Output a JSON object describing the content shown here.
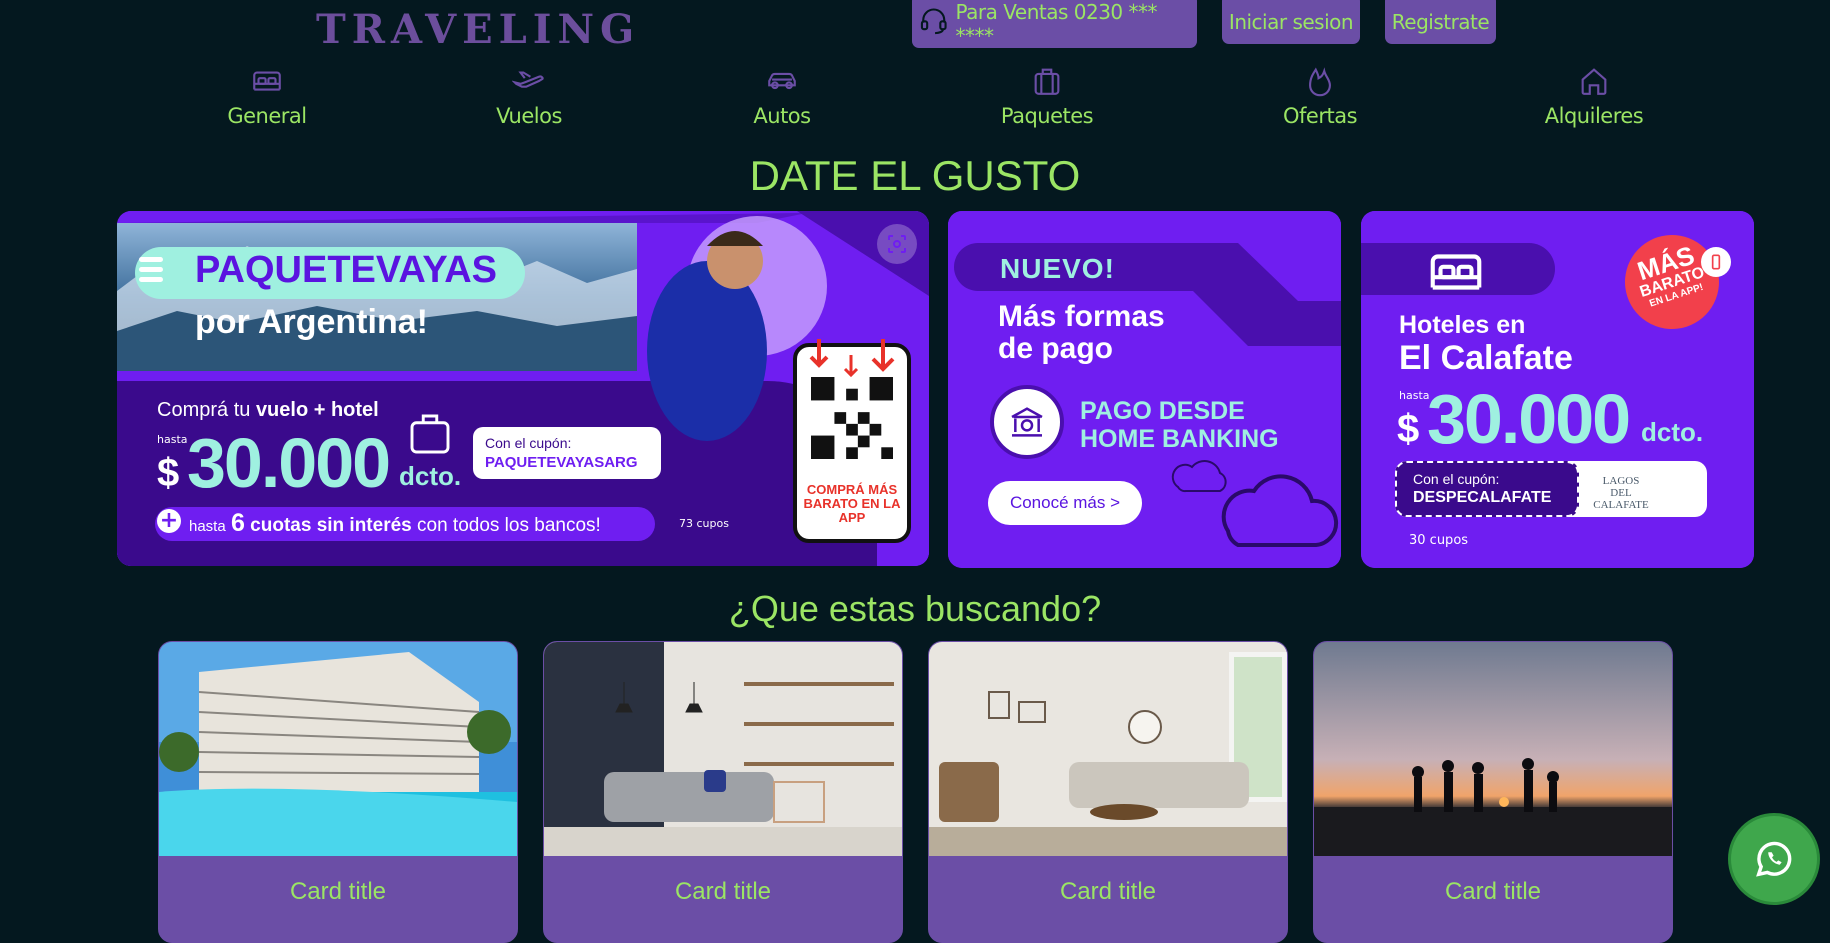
{
  "header": {
    "logo": "TRAVELING",
    "sales_label": "Para Ventas 0230 *** ****",
    "login_label": "Iniciar sesion",
    "register_label": "Registrate"
  },
  "nav": [
    {
      "label": "General",
      "icon": "bed-icon"
    },
    {
      "label": "Vuelos",
      "icon": "plane-icon"
    },
    {
      "label": "Autos",
      "icon": "car-icon"
    },
    {
      "label": "Paquetes",
      "icon": "suitcase-icon"
    },
    {
      "label": "Ofertas",
      "icon": "flame-icon"
    },
    {
      "label": "Alquileres",
      "icon": "house-icon"
    }
  ],
  "promo_heading": "DATE EL GUSTO",
  "banners": {
    "b1": {
      "brand": "PAQUETEVAYAS",
      "sub": "por Argentina!",
      "buy_pre": "Comprá tu",
      "buy_bold": "vuelo + hotel",
      "hasta": "hasta",
      "currency": "$",
      "amount": "30.000",
      "dcto": "dcto.",
      "coupon_label": "Con el cupón:",
      "coupon_code": "PAQUETEVAYASARG",
      "cuotas_pre": "hasta",
      "cuotas_num": "6",
      "cuotas_bold": "cuotas sin interés",
      "cuotas_post": "con todos los bancos!",
      "cupos": "73 cupos",
      "qr_text": "COMPRÁ MÁS BARATO EN LA APP"
    },
    "b2": {
      "badge": "NUEVO!",
      "title_line1": "Más formas",
      "title_line2": "de pago",
      "pago_line1": "PAGO DESDE",
      "pago_line2": "HOME BANKING",
      "cta": "Conocé más >"
    },
    "b3": {
      "sticker_line1": "MÁS",
      "sticker_line2": "BARATO",
      "sticker_line3": "EN LA APP!",
      "title_line1": "Hoteles en",
      "title_line2": "El Calafate",
      "hasta": "hasta",
      "currency": "$",
      "amount": "30.000",
      "dcto": "dcto.",
      "coupon_label": "Con el cupón:",
      "coupon_code": "DESPECALAFATE",
      "partner": "LAGOS DEL CALAFATE",
      "cupos": "30 cupos"
    }
  },
  "search_heading": "¿Que estas buscando?",
  "cards": [
    {
      "title": "Card title"
    },
    {
      "title": "Card title"
    },
    {
      "title": "Card title"
    },
    {
      "title": "Card title"
    }
  ],
  "colors": {
    "background": "#04181f",
    "accent_green": "#9be564",
    "accent_purple": "#6b4ea6",
    "banner_purple": "#6f1ef1",
    "whatsapp_green": "#3fa74c"
  },
  "floating": {
    "icon": "whatsapp-icon"
  }
}
